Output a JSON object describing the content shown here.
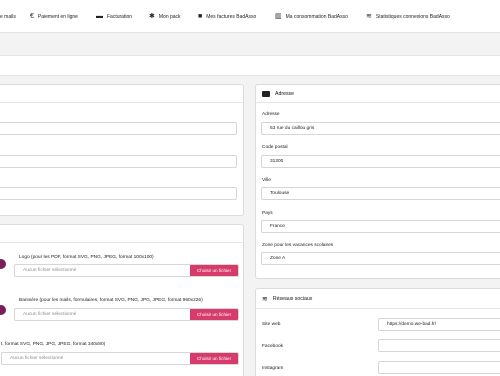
{
  "tabs": [
    {
      "label": "e mails",
      "icon": ""
    },
    {
      "label": "Paiement en ligne",
      "icon": "€"
    },
    {
      "label": "Facturation",
      "icon": "▬"
    },
    {
      "label": "Mon pack",
      "icon": "✱"
    },
    {
      "label": "Mes factures BadAsso",
      "icon": "■"
    },
    {
      "label": "Ma consommation BadAsso",
      "icon": "▥"
    },
    {
      "label": "Statistiques connexions BadAsso",
      "icon": "≋"
    }
  ],
  "address": {
    "title": "Adresse",
    "adresse_label": "Adresse",
    "adresse_value": "53 rue du caillou gris",
    "cp_label": "Code postal",
    "cp_value": "31200",
    "ville_label": "Ville",
    "ville_value": "Toulouse",
    "pays_label": "Pays",
    "pays_value": "France",
    "zone_label": "Zone pour les vacances scolaires",
    "zone_value": "Zone A"
  },
  "social": {
    "title": "Réseaux sociaux",
    "web_label": "Site web",
    "web_value": "https://demo.we-bad.fr/",
    "facebook_label": "Facebook",
    "facebook_value": "",
    "instagram_label": "Instagram",
    "instagram_value": ""
  },
  "images": {
    "logo_label": "Logo (pour les PDF, format SVG, PNG, JPEG, format 100x100)",
    "logo_placeholder": "Aucun fichier sélectionné",
    "banner_label": "Bannière (pour les mails, formulaires, format SVG, PNG, JPG, JPEG, format 960x226)",
    "banner_placeholder": "Aucun fichier sélectionné",
    "third_label": "t, format SVG, PNG, JPG, JPEG, format 340x80)",
    "third_placeholder": "Aucun fichier sélectionné",
    "choose_label": "Choisir un fichier"
  },
  "colors": {
    "accent": "#d63b6b",
    "avatar": "#7a1f5c"
  }
}
